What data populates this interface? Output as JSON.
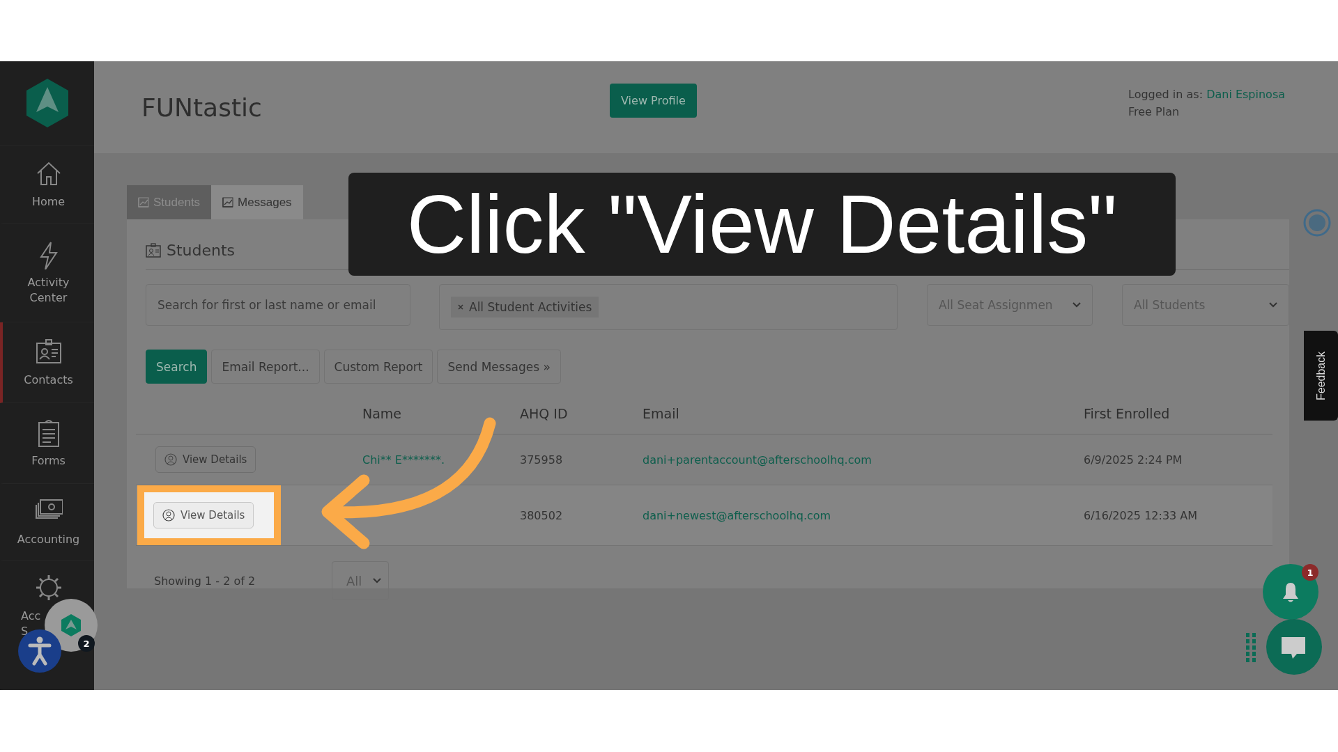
{
  "sidebar": {
    "items": [
      {
        "label": "Home",
        "active": false
      },
      {
        "label": "Activity Center",
        "active": false
      },
      {
        "label": "Contacts",
        "active": true
      },
      {
        "label": "Forms",
        "active": false
      },
      {
        "label": "Accounting",
        "active": false
      },
      {
        "label": "Acc\nS",
        "active": false
      }
    ]
  },
  "header": {
    "title": "FUNtastic",
    "button": "View Profile",
    "logged_in_label": "Logged in as:",
    "user": "Dani Espinosa",
    "plan": "Free Plan"
  },
  "tabs": [
    {
      "label": "Students",
      "selected": true
    },
    {
      "label": "Messages",
      "selected": false
    }
  ],
  "panel": {
    "title": "Students",
    "search": {
      "placeholder": "Search for first or last name or email"
    },
    "activity_filter": {
      "chips": [
        "All Student Activities"
      ]
    },
    "seat_select": "All Seat Assignmen",
    "students_select": "All Students",
    "buttons": [
      {
        "label": "Search",
        "kind": "primary"
      },
      {
        "label": "Email Report...",
        "kind": "secondary"
      },
      {
        "label": "Custom Report",
        "kind": "secondary"
      },
      {
        "label": "Send Messages »",
        "kind": "secondary"
      }
    ],
    "table": {
      "columns": [
        "Name",
        "AHQ ID",
        "Email",
        "First Enrolled"
      ],
      "rows": [
        {
          "action": "View Details",
          "name": "Chi** E*******.",
          "ahq_id": "375958",
          "email": "dani+parentaccount@afterschoolhq.com",
          "first_enrolled": "6/9/2025 2:24 PM",
          "highlighted": false
        },
        {
          "action": "View Details",
          "ahq_id": "380502",
          "email": "dani+newest@afterschoolhq.com",
          "first_enrolled": "6/16/2025 12:33 AM",
          "highlighted": true
        }
      ]
    },
    "showing": "Showing 1 - 2 of 2",
    "page_size": "All"
  },
  "instruction": "Click \"View Details\"",
  "feedback": "Feedback",
  "notifications": {
    "count": "1"
  },
  "widget_badge": "2"
}
